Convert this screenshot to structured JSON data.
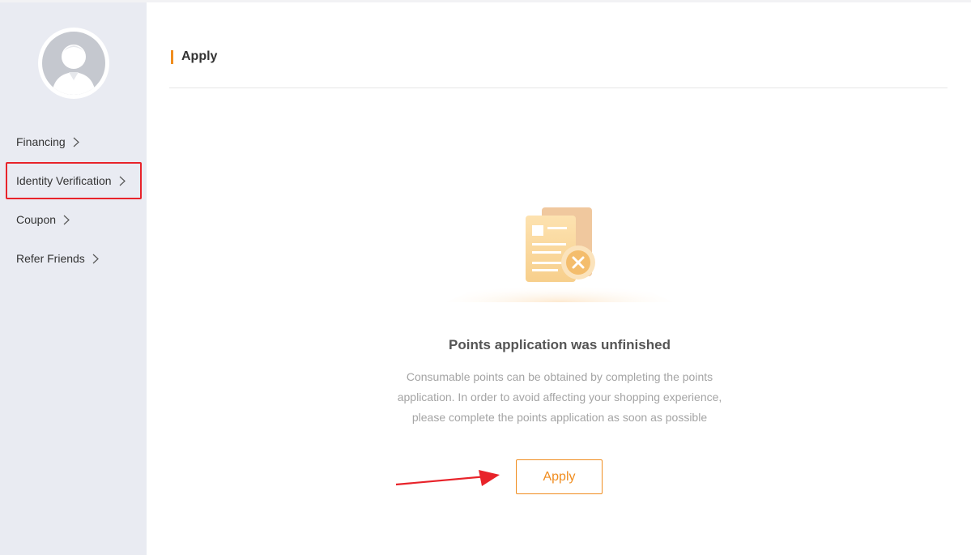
{
  "sidebar": {
    "avatar_icon": "user-avatar-icon",
    "items": [
      {
        "label": "Financing",
        "icon": "chevron-right-icon"
      },
      {
        "label": "Identity Verification",
        "icon": "chevron-right-icon",
        "highlighted": true
      },
      {
        "label": "Coupon",
        "icon": "chevron-right-icon"
      },
      {
        "label": "Refer Friends",
        "icon": "chevron-right-icon"
      }
    ]
  },
  "main": {
    "title": "Apply",
    "empty_state": {
      "illustration_icon": "document-error-icon",
      "title": "Points application was unfinished",
      "description_lines": [
        "Consumable points can be obtained by completing the points",
        "application. In order to avoid affecting your shopping experience,",
        "please complete the points application as soon as possible"
      ],
      "button_label": "Apply"
    },
    "annotation": {
      "icon": "red-arrow-icon"
    }
  },
  "colors": {
    "accent": "#f08d1f",
    "sidebar_bg": "#e9ebf2",
    "highlight_border": "#e8232a",
    "annotation_arrow": "#e8232a"
  }
}
